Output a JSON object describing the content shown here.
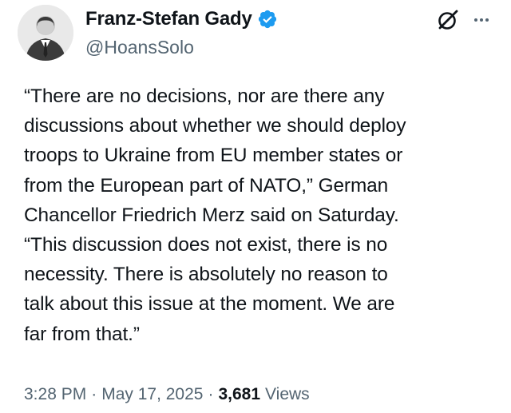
{
  "author": {
    "display_name": "Franz-Stefan Gady",
    "handle": "@HoansSolo",
    "avatar_icon": "person-avatar",
    "verified_icon": "verified-badge-icon",
    "verified_color": "#1d9bf0"
  },
  "actions": {
    "grok_icon": "grok-icon",
    "more_icon": "more-options-icon"
  },
  "tweet": {
    "text": "“There are no decisions, nor are there any\ndiscussions about whether we should deploy\ntroops to Ukraine from EU member states or\nfrom the European part of NATO,” German\nChancellor Friedrich Merz said on Saturday.\n“This discussion does not exist, there is no\nnecessity. There is absolutely no reason to\ntalk about this issue at the moment. We are\nfar from that.”"
  },
  "meta": {
    "time": "3:28 PM",
    "separator": "·",
    "date": "May 17, 2025",
    "views_count": "3,681",
    "views_label": "Views"
  },
  "colors": {
    "text_primary": "#0f1419",
    "text_secondary": "#536471",
    "background": "#ffffff"
  }
}
